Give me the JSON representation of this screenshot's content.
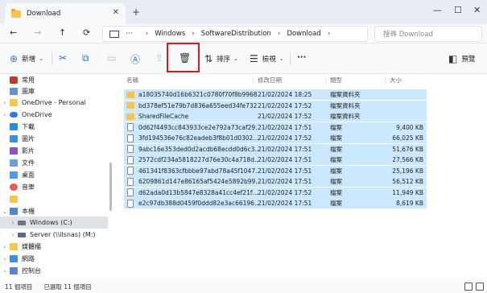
{
  "window": {
    "tab_title": "Download",
    "tab_close": "✕",
    "new_tab": "+",
    "minimize": "—",
    "maximize": "☐",
    "close": "✕"
  },
  "nav": {
    "back": "←",
    "forward": "→",
    "up": "↑",
    "refresh": "⟳"
  },
  "address": {
    "more": "···",
    "crumbs": [
      "Windows",
      "SoftwareDistribution",
      "Download"
    ],
    "search_placeholder": "搜尋 Download"
  },
  "toolbar": {
    "new_label": "新增",
    "sort_label": "排序",
    "view_label": "檢視",
    "more_label": "···",
    "preview_label": "預覽"
  },
  "sidebar": {
    "items": [
      {
        "label": "常用",
        "icon": "home-icon"
      },
      {
        "label": "圖庫",
        "icon": "gallery-icon"
      },
      {
        "label": "OneDrive - Personal",
        "icon": "folder-icon"
      },
      {
        "label": "OneDrive",
        "icon": "cloud-icon"
      },
      {
        "label": "下載",
        "icon": "download-icon"
      },
      {
        "label": "圖片",
        "icon": "pictures-icon"
      },
      {
        "label": "影片",
        "icon": "videos-icon"
      },
      {
        "label": "文件",
        "icon": "documents-icon"
      },
      {
        "label": "桌面",
        "icon": "desktop-icon"
      },
      {
        "label": "音樂",
        "icon": "music-icon"
      },
      {
        "label": "",
        "icon": "folder-icon"
      },
      {
        "label": "本機",
        "icon": "this-pc-icon"
      },
      {
        "label": "Windows (C:)",
        "icon": "drive-icon"
      },
      {
        "label": "Server (\\\\ilsnas) (M:)",
        "icon": "network-drive-icon"
      },
      {
        "label": "媒體櫃",
        "icon": "libraries-icon"
      },
      {
        "label": "網路",
        "icon": "network-icon"
      },
      {
        "label": "控制台",
        "icon": "control-panel-icon"
      }
    ]
  },
  "columns": {
    "name": "名稱",
    "date": "修改日期",
    "type": "類型",
    "size": "大小"
  },
  "files": [
    {
      "name": "a18035740d16b6321c0780f70f8b9968",
      "date": "21/02/2024 18:25",
      "type": "檔案資料夾",
      "size": "",
      "kind": "folder"
    },
    {
      "name": "bd378ef51e79b7d836a655eed34fe732",
      "date": "21/02/2024 17:52",
      "type": "檔案資料夾",
      "size": "",
      "kind": "folder"
    },
    {
      "name": "SharedFileCache",
      "date": "21/02/2024 17:52",
      "type": "檔案資料夾",
      "size": "",
      "kind": "folder"
    },
    {
      "name": "0d62f4493cc843933ce2e792a73caf29…",
      "date": "21/02/2024 17:51",
      "type": "檔案",
      "size": "9,400 KB",
      "kind": "file"
    },
    {
      "name": "3fd194536e76c82eadeb3f8b01d0302…",
      "date": "21/02/2024 17:52",
      "type": "檔案",
      "size": "66,025 KB",
      "kind": "file"
    },
    {
      "name": "9abc16e353ded0d2acdb68ecdd0d6c3…",
      "date": "21/02/2024 17:51",
      "type": "檔案",
      "size": "51,676 KB",
      "kind": "file"
    },
    {
      "name": "2572cdf234a5818227d76e30c4a718d…",
      "date": "21/02/2024 17:51",
      "type": "檔案",
      "size": "27,566 KB",
      "kind": "file"
    },
    {
      "name": "461341f8363cfbbbe97abd78a45f1047…",
      "date": "21/02/2024 17:51",
      "type": "檔案",
      "size": "25,196 KB",
      "kind": "file"
    },
    {
      "name": "6209861d147e86165af5424e5892b99…",
      "date": "21/02/2024 17:51",
      "type": "檔案",
      "size": "56,512 KB",
      "kind": "file"
    },
    {
      "name": "d62ada0d13b5847e8328a41cc4ef21f…",
      "date": "21/02/2024 17:52",
      "type": "檔案",
      "size": "11,949 KB",
      "kind": "file"
    },
    {
      "name": "e2c97db388d0459f0ddd82e3ac66196…",
      "date": "21/02/2024 17:51",
      "type": "檔案",
      "size": "8,619 KB",
      "kind": "file"
    }
  ],
  "status": {
    "count": "11 個項目",
    "selected": "已選取 11 個項目"
  }
}
